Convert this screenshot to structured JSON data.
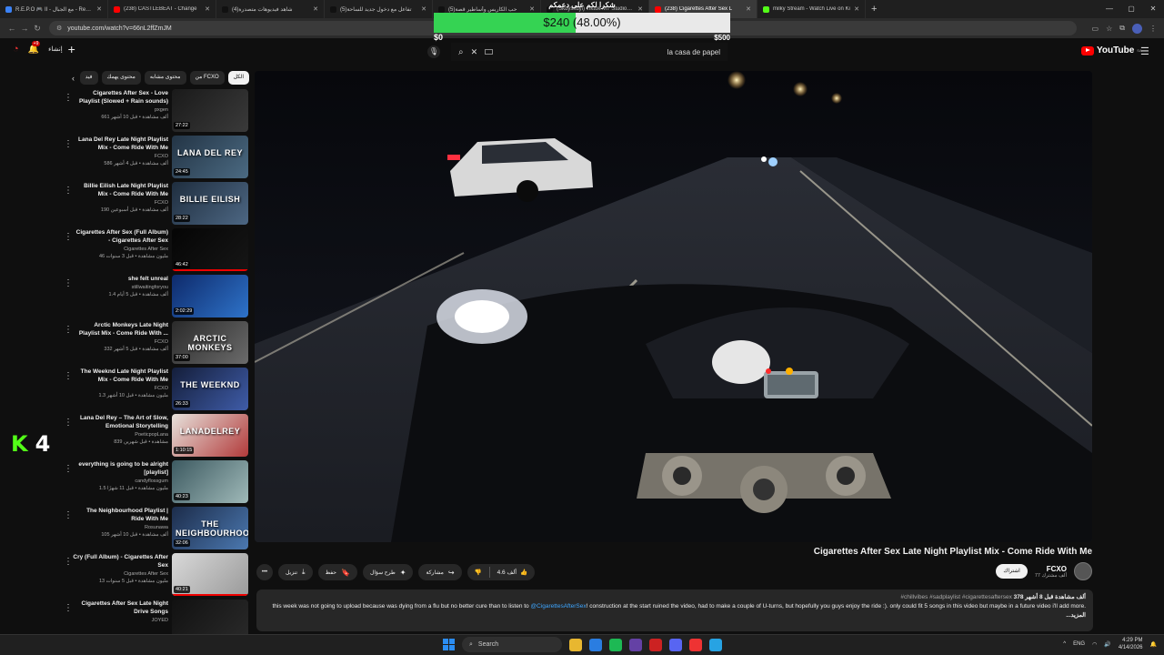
{
  "tabs": [
    {
      "title": "R.E.P.O 🎮 II - مع الجبال - Resto",
      "favicon_color": "#3b82f6",
      "active": false
    },
    {
      "title": "(238) CASTLEBEAT - Change",
      "favicon_color": "#ff0000",
      "active": false
    },
    {
      "title": "(4)شاهد فيديوهات متصدرة",
      "favicon_color": "#111111",
      "active": false
    },
    {
      "title": "(5)تفاعل مع دخول جديد للساحة",
      "favicon_color": "#111111",
      "active": false
    },
    {
      "title": "(5)حب الكاريس وأساطير قصة",
      "favicon_color": "#111111",
      "active": false
    },
    {
      "title": "(Skuyskuyi) Tiktok MT Studios | M",
      "favicon_color": "#111111",
      "active": false
    },
    {
      "title": "(238) Cigarettes After Sex L",
      "favicon_color": "#ff0000",
      "active": true
    },
    {
      "title": "milky Stream - Watch Live on Ki",
      "favicon_color": "#53fc18",
      "active": false
    }
  ],
  "browser": {
    "url": "youtube.com/watch?v=66nL2ffZmJM",
    "new_tab": "+",
    "window_controls": [
      "—",
      "▢",
      "✕"
    ]
  },
  "donation": {
    "title": "شكرا لكم على دعمكم",
    "amount_label": "$240 (48.00%)",
    "progress": 0.48,
    "min_label": "$0",
    "max_label": "$500"
  },
  "youtube_header": {
    "create_label": "إنشاء",
    "notification_count": "+9",
    "search_value": "la casa de papel",
    "logo_text": "YouTube",
    "region": "SA"
  },
  "chips": [
    {
      "label": "الكل",
      "selected": true
    },
    {
      "label": "من FCXO",
      "selected": false
    },
    {
      "label": "محتوى مشابه",
      "selected": false
    },
    {
      "label": "محتوى يهمك",
      "selected": false
    },
    {
      "label": "فيد",
      "selected": false
    }
  ],
  "recommendations": [
    {
      "title": "Cigarettes After Sex - Love Playlist (Slowed + Rain sounds)",
      "channel": "pxgen",
      "meta": "661 ألف مشاهدة • قبل 10 أشهر",
      "duration": "27:22",
      "thumb_colors": [
        "#1a1a1a",
        "#3a3a3a"
      ],
      "thumb_text": "",
      "watched": false
    },
    {
      "title": "Lana Del Rey Late Night Playlist Mix - Come Ride With Me",
      "channel": "FCXO",
      "meta": "586 ألف مشاهدة • قبل 4 أشهر",
      "duration": "24:45",
      "thumb_colors": [
        "#233445",
        "#4b6a82"
      ],
      "thumb_text": "LANA DEL REY",
      "watched": false
    },
    {
      "title": "Billie Eilish Late Night Playlist Mix - Come Ride With Me",
      "channel": "FCXO",
      "meta": "190 ألف مشاهدة • قبل أسبوعين",
      "duration": "28:22",
      "thumb_colors": [
        "#1f2e3f",
        "#4d6783"
      ],
      "thumb_text": "BILLIE EILISH",
      "watched": false
    },
    {
      "title": "Cigarettes After Sex (Full Album) - Cigarettes After Sex",
      "channel": "Cigarettes After Sex",
      "meta": "46 مليون مشاهدة • قبل 3 سنوات",
      "duration": "46:42",
      "thumb_colors": [
        "#050505",
        "#161616"
      ],
      "thumb_text": "",
      "watched": true
    },
    {
      "title": "she felt unreal",
      "channel": "stillwaitingforyou",
      "meta": "1.4 ألف مشاهدة • قبل 5 أيام",
      "duration": "2:02:29",
      "thumb_colors": [
        "#0e2a6b",
        "#2e73c9"
      ],
      "thumb_text": "",
      "watched": false
    },
    {
      "title": "Arctic Monkeys Late Night Playlist Mix - Come Ride With ...",
      "channel": "FCXO",
      "meta": "332 ألف مشاهدة • قبل 5 أشهر",
      "duration": "37:00",
      "thumb_colors": [
        "#2a2a2a",
        "#6b6b6b"
      ],
      "thumb_text": "ARCTIC MONKEYS",
      "watched": false
    },
    {
      "title": "The Weeknd Late Night Playlist Mix - Come Ride With Me",
      "channel": "FCXO",
      "meta": "1.3 مليون مشاهدة • قبل 10 أشهر",
      "duration": "26:33",
      "thumb_colors": [
        "#141e3a",
        "#3f5ca8"
      ],
      "thumb_text": "THE WEEKND",
      "watched": false
    },
    {
      "title": "Lana Del Rey – The Art of Slow, Emotional Storytelling",
      "channel": "PoeticpopLana",
      "meta": "839 مشاهدة • قبل شهرين",
      "duration": "1:10:15",
      "thumb_colors": [
        "#e7e2dc",
        "#b23a3a"
      ],
      "thumb_text": "LANADELREY",
      "watched": false
    },
    {
      "title": "everything is going to be alright [playlist]",
      "channel": "candyflossgum",
      "meta": "1.5 مليون مشاهدة • قبل 11 شهرًا",
      "duration": "40:23",
      "thumb_colors": [
        "#3d5a61",
        "#9fb9b8"
      ],
      "thumb_text": "",
      "watched": false
    },
    {
      "title": "The Neighbourhood Playlist | Ride With Me",
      "channel": "Rosunawa",
      "meta": "105 ألف مشاهدة • قبل 10 أشهر",
      "duration": "32:06",
      "thumb_colors": [
        "#1c2c4a",
        "#4b78b0"
      ],
      "thumb_text": "THE NEIGHBOURHOOD",
      "watched": false
    },
    {
      "title": "Cry (Full Album) - Cigarettes After Sex",
      "channel": "Cigarettes After Sex",
      "meta": "13 مليون مشاهدة • قبل 5 سنوات",
      "duration": "40:21",
      "thumb_colors": [
        "#d9d9d9",
        "#9a9a9a"
      ],
      "thumb_text": "",
      "watched": true
    },
    {
      "title": "Cigarettes After Sex Late Night Drive Songs",
      "channel": "JOYED",
      "meta": "",
      "duration": "",
      "thumb_colors": [
        "#111111",
        "#2a2a2a"
      ],
      "thumb_text": "",
      "watched": false
    }
  ],
  "overlay_badge": {
    "k": "K",
    "number": "4"
  },
  "video": {
    "title": "Cigarettes After Sex Late Night Playlist Mix - Come Ride With Me",
    "likes": "4.6 ألف",
    "share_label": "مشاركة",
    "ask_label": "طرح سؤال",
    "save_label": "حفظ",
    "download_label": "تنزيل",
    "more_label": "•••"
  },
  "channel": {
    "name": "FCXO",
    "subscribers": "77 ألف مشترك",
    "subscribe_label": "اشتراك"
  },
  "description": {
    "stats": "378 ألف مشاهدة قبل 8 أشهر",
    "tags": "#chillvibes #sadplaylist #cigarettesaftersex",
    "text_before": "this week was not going to upload because was dying from a flu but no better cure than to listen to ",
    "mention": "@CigarettesAfterSex",
    "text_after": "! construction at the start ruined the video, had to make a couple of U-turns, but hopefully you guys enjoy the ride :). only could fit 5 songs in this video but maybe in a future video i'll add more.",
    "more_label": "...المزيد"
  },
  "taskbar": {
    "search_placeholder": "Search",
    "lang": "ENG",
    "time": "4:29 PM",
    "date": "4/14/2026",
    "app_colors": [
      "#e8b730",
      "#2a7de1",
      "#1db954",
      "#6441a5",
      "#cc2222",
      "#5865f2",
      "#e33",
      "#27a3e3"
    ]
  },
  "colors": {
    "accent_red": "#ff0000",
    "progress_green": "#35d353",
    "kick_green": "#53fc18",
    "link_blue": "#3ea6ff"
  }
}
